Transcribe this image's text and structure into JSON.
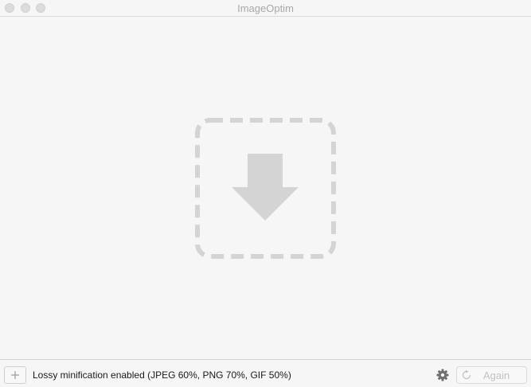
{
  "window": {
    "title": "ImageOptim"
  },
  "drop_area": {
    "icon": "download-arrow-icon",
    "icon_color": "#d4d4d4"
  },
  "toolbar": {
    "add_icon": "plus-icon",
    "status": "Lossy minification enabled (JPEG 60%, PNG 70%, GIF 50%)",
    "settings_icon": "gear-icon",
    "again_icon": "refresh-icon",
    "again_label": "Again"
  }
}
